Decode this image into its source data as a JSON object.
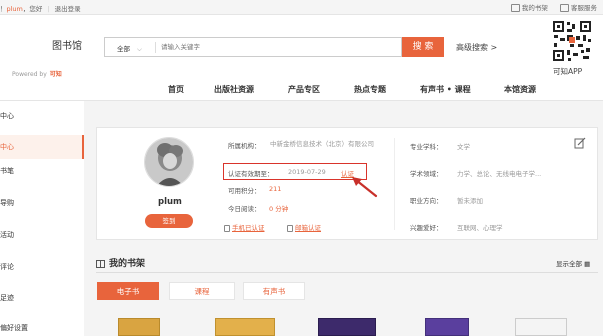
{
  "topbar": {
    "greeting_prefix": "！",
    "username": "plum",
    "greeting_suffix": "，您好",
    "logout": "退出登录",
    "my_shelf": "我的书架",
    "customer_service": "客服服务"
  },
  "header": {
    "title": "图书馆",
    "powered_by": "Powered by",
    "powered_brand": "可知",
    "search": {
      "scope": "全部",
      "placeholder": "请输入关键字",
      "button": "搜 索"
    },
    "advanced_search": "高级搜索 >",
    "app_label": "可知APP"
  },
  "nav": {
    "items": [
      "首页",
      "出版社资源",
      "产品专区",
      "热点专题",
      "有声书 • 课程",
      "本馆资源"
    ]
  },
  "sidebar": {
    "heading": "中心",
    "items": [
      "中心",
      "书笔",
      "导购",
      "活动",
      "评论",
      "足迹",
      "偏好设置"
    ]
  },
  "profile": {
    "username": "plum",
    "signin_button": "签到",
    "org_label": "所属机构：",
    "org_value": "中新金桥信息技术（北京）有限公司",
    "cert_label": "认证有效期至：",
    "cert_date": "2019-07-29",
    "cert_link": "认证",
    "points_label": "可用积分：",
    "points_value": "211",
    "reading_label": "今日阅读：",
    "reading_value": "0 分钟",
    "phone_cert": "手机已认证",
    "email_cert": "邮箱认证",
    "major_label": "专业学科：",
    "major_value": "文学",
    "field_label": "学术领域：",
    "field_value": "力学、总论、无线电电子学...",
    "job_label": "职业方向：",
    "job_value": "暂未添加",
    "hobby_label": "兴趣爱好：",
    "hobby_value": "互联网、心理学"
  },
  "bookshelf": {
    "title": "我的书架",
    "show_all": "显示全部",
    "tabs": [
      "电子书",
      "课程",
      "有声书"
    ]
  },
  "colors": {
    "accent": "#e8643c",
    "highlight": "#d9342b"
  }
}
